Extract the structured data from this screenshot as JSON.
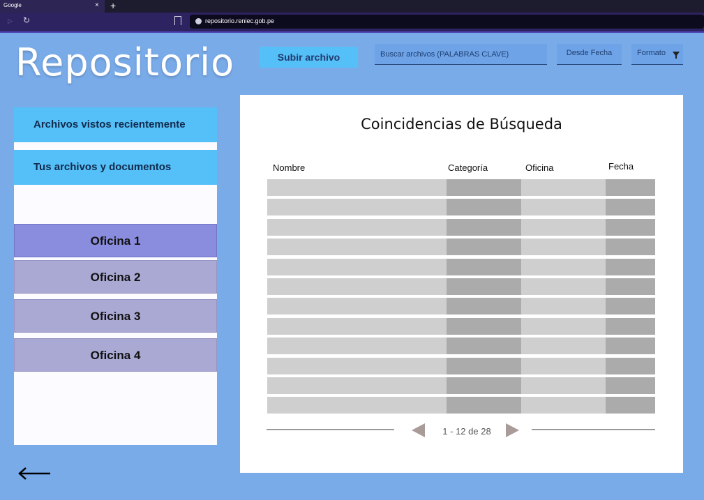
{
  "browser": {
    "tab_title": "Google",
    "tab_close": "×",
    "new_tab": "+",
    "url": "repositorio.reniec.gob.pe"
  },
  "header": {
    "logo": "Repositorio",
    "upload_label": "Subir archivo",
    "search_placeholder": "Buscar archivos (PALABRAS CLAVE)",
    "date_label": "Desde Fecha",
    "format_label": "Formato"
  },
  "sidebar": {
    "links": [
      {
        "label": "Archivos vistos recientemente"
      },
      {
        "label": "Tus archivos y documentos"
      }
    ],
    "offices": [
      {
        "label": "Oficina 1",
        "active": true
      },
      {
        "label": "Oficina 2",
        "active": false
      },
      {
        "label": "Oficina 3",
        "active": false
      },
      {
        "label": "Oficina 4",
        "active": false
      }
    ]
  },
  "results": {
    "title": "Coincidencias de Búsqueda",
    "columns": [
      "Nombre",
      "Categoría",
      "Oficina",
      "Fecha"
    ],
    "row_count": 12,
    "pagination": "1 - 12 de 28"
  },
  "colors": {
    "page_bg": "#79abe9",
    "accent": "#55bff7",
    "office_active": "#8a8cdd",
    "office_inactive": "#aaa9d4"
  }
}
